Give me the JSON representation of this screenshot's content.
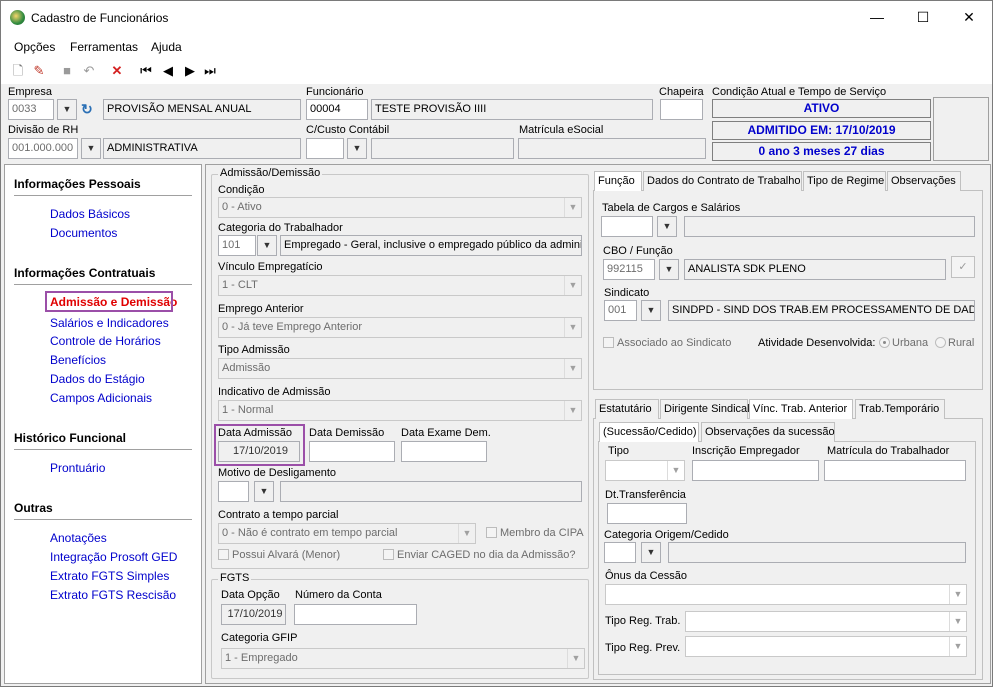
{
  "window": {
    "title": "Cadastro de Funcionários",
    "min": "—",
    "max": "☐",
    "close": "✕"
  },
  "menu": [
    "Opções",
    "Ferramentas",
    "Ajuda"
  ],
  "header": {
    "empresa_label": "Empresa",
    "empresa_code": "0033",
    "empresa_name": "PROVISÃO MENSAL ANUAL",
    "funcionario_label": "Funcionário",
    "funcionario_code": "00004",
    "funcionario_name": "TESTE PROVISÃO IIII",
    "chapeira_label": "Chapeira",
    "condicao_label": "Condição Atual e Tempo de Serviço",
    "status1": "ATIVO",
    "status2": "ADMITIDO EM: 17/10/2019",
    "status3": "0 ano 3 meses 27 dias",
    "divisao_label": "Divisão de RH",
    "divisao_code": "001.000.000",
    "divisao_name": "ADMINISTRATIVA",
    "custo_label": "C/Custo Contábil",
    "matricula_label": "Matrícula eSocial"
  },
  "sidebar": {
    "sec1": "Informações Pessoais",
    "sec1_items": [
      "Dados Básicos",
      "Documentos"
    ],
    "sec2": "Informações Contratuais",
    "sec2_items": [
      "Admissão e Demissão",
      "Salários e Indicadores",
      "Controle de Horários",
      "Benefícios",
      "Dados do Estágio",
      "Campos Adicionais"
    ],
    "sec3": "Histórico Funcional",
    "sec3_items": [
      "Prontuário"
    ],
    "sec4": "Outras",
    "sec4_items": [
      "Anotações",
      "Integração Prosoft GED",
      "Extrato FGTS Simples",
      "Extrato FGTS Rescisão"
    ]
  },
  "admissao": {
    "group": "Admissão/Demissão",
    "condicao_label": "Condição",
    "condicao": "0 - Ativo",
    "categoria_label": "Categoria do Trabalhador",
    "categoria_code": "101",
    "categoria_desc": "Empregado - Geral, inclusive o empregado público da administ",
    "vinculo_label": "Vínculo Empregatício",
    "vinculo": "1 - CLT",
    "emprego_label": "Emprego Anterior",
    "emprego": "0 - Já teve Emprego Anterior",
    "tipo_label": "Tipo Admissão",
    "tipo": "Admissão",
    "indicativo_label": "Indicativo de Admissão",
    "indicativo": "1 - Normal",
    "data_adm_label": "Data Admissão",
    "data_adm": "17/10/2019",
    "data_dem_label": "Data Demissão",
    "data_exame_label": "Data Exame Dem.",
    "motivo_label": "Motivo de Desligamento",
    "contrato_label": "Contrato a tempo parcial",
    "contrato": "0 - Não é contrato em tempo parcial",
    "cipa": "Membro da CIPA",
    "alvara": "Possui Alvará (Menor)",
    "caged": "Enviar CAGED no dia da Admissão?"
  },
  "fgts": {
    "group": "FGTS",
    "data_label": "Data Opção",
    "data": "17/10/2019",
    "conta_label": "Número da Conta",
    "gfip_label": "Categoria GFIP",
    "gfip": "1 - Empregado"
  },
  "tabs_top": [
    "Função",
    "Dados do Contrato de Trabalho",
    "Tipo de Regime",
    "Observações"
  ],
  "funcao": {
    "tabela_label": "Tabela de Cargos e Salários",
    "cbo_label": "CBO / Função",
    "cbo_code": "992115",
    "cbo_desc": "ANALISTA SDK PLENO",
    "sindicato_label": "Sindicato",
    "sind_code": "001",
    "sind_desc": "SINDPD - SIND DOS TRAB.EM PROCESSAMENTO DE DADOS ES",
    "associado": "Associado ao Sindicato",
    "atividade_label": "Atividade Desenvolvida:",
    "urbana": "Urbana",
    "rural": "Rural"
  },
  "tabs_bottom": [
    "Estatutário",
    "Dirigente Sindical",
    "Vínc. Trab. Anterior",
    "Trab.Temporário"
  ],
  "subtabs": [
    "(Sucessão/Cedido)",
    "Observações da sucessão"
  ],
  "vinc": {
    "tipo_label": "Tipo",
    "inscricao_label": "Inscrição Empregador",
    "matricula_label": "Matrícula do Trabalhador",
    "dt_label": "Dt.Transferência",
    "cat_label": "Categoria Origem/Cedido",
    "onus_label": "Ônus da Cessão",
    "regtrab_label": "Tipo Reg. Trab.",
    "regprev_label": "Tipo Reg. Prev."
  },
  "colors": {
    "link": "#0000cc",
    "selected": "#e00000",
    "highlight": "#9b4fa8"
  }
}
